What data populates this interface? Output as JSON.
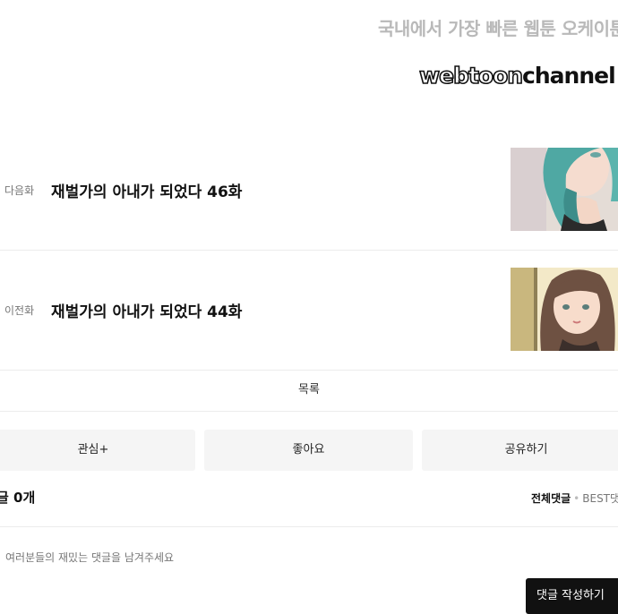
{
  "banner": {
    "tagline": "국내에서 가장 빠른 웹툰 오케이툰",
    "logo_part1": "webtoon",
    "logo_part2": "channel"
  },
  "episodes": {
    "next": {
      "kind": "다음화",
      "title": "재벌가의 아내가 되었다 46화"
    },
    "prev": {
      "kind": "이전화",
      "title": "재벌가의 아내가 되었다 44화"
    }
  },
  "list_label": "목록",
  "actions": {
    "favorite": "관심+",
    "like": "좋아요",
    "share": "공유하기"
  },
  "comments": {
    "count_label": "글 0개",
    "sort_all": "전체댓글",
    "sort_separator": "•",
    "sort_best": "BEST댓글",
    "placeholder": "여러분들의 재밌는 댓글을 남겨주세요",
    "write_label": "댓글 작성하기"
  },
  "colors": {
    "tagline": "#b9b9b9",
    "button_bg": "#f5f5f5",
    "write_button_bg": "#111111"
  }
}
